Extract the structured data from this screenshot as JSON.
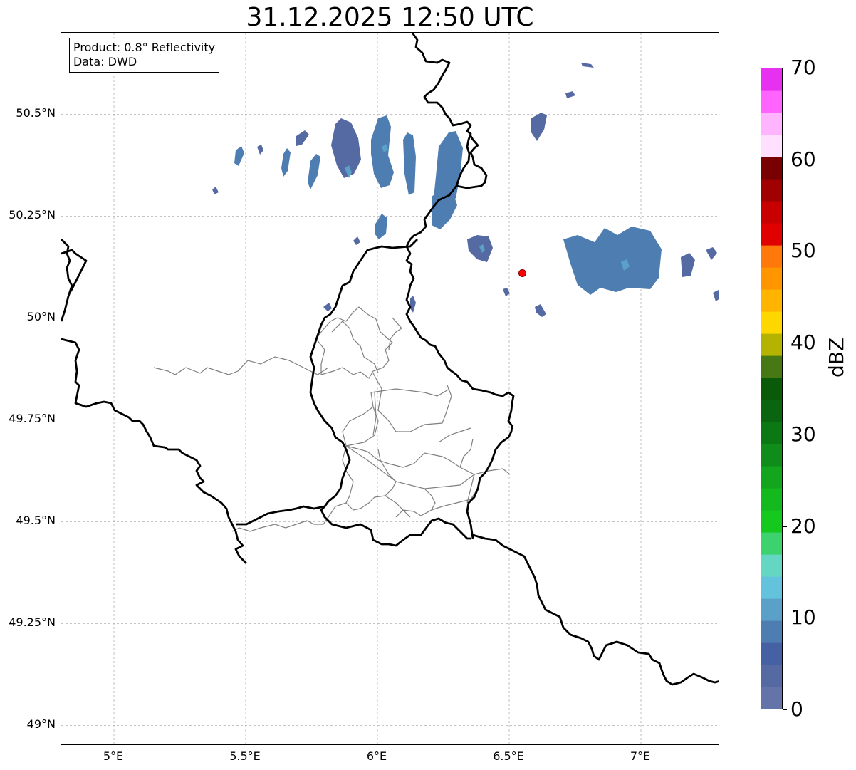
{
  "title": "31.12.2025 12:50 UTC",
  "info": {
    "product": "Product: 0.8° Reflectivity",
    "data": "Data: DWD"
  },
  "map": {
    "lon_range": [
      4.8,
      7.3
    ],
    "lat_range": [
      48.95,
      50.7
    ],
    "lat_ticks": [
      {
        "value": 50.5,
        "label": "50.5°N"
      },
      {
        "value": 50.25,
        "label": "50.25°N"
      },
      {
        "value": 50.0,
        "label": "50°N"
      },
      {
        "value": 49.75,
        "label": "49.75°N"
      },
      {
        "value": 49.5,
        "label": "49.5°N"
      },
      {
        "value": 49.25,
        "label": "49.25°N"
      },
      {
        "value": 49.0,
        "label": "49°N"
      }
    ],
    "lon_ticks": [
      {
        "value": 5.0,
        "label": "5°E"
      },
      {
        "value": 5.5,
        "label": "5.5°E"
      },
      {
        "value": 6.0,
        "label": "6°E"
      },
      {
        "value": 6.5,
        "label": "6.5°E"
      },
      {
        "value": 7.0,
        "label": "7°E"
      }
    ],
    "radar_site": {
      "lon": 6.55,
      "lat": 50.11
    },
    "colors": {
      "border": "#000000",
      "province_border": "#808080",
      "grid": "#b0b0b0",
      "radar_marker": "#ff0000"
    }
  },
  "colorbar": {
    "label": "dBZ",
    "min": 0,
    "max": 70,
    "ticks": [
      {
        "value": 70,
        "label": "70"
      },
      {
        "value": 60,
        "label": "60"
      },
      {
        "value": 50,
        "label": "50"
      },
      {
        "value": 40,
        "label": "40"
      },
      {
        "value": 30,
        "label": "30"
      },
      {
        "value": 20,
        "label": "20"
      },
      {
        "value": 10,
        "label": "10"
      },
      {
        "value": 0,
        "label": "0"
      }
    ],
    "colors": [
      "#6473a8",
      "#5569a3",
      "#4560a3",
      "#4e7db2",
      "#5aa0c8",
      "#64c3dc",
      "#64d7c3",
      "#3cd26e",
      "#14c81e",
      "#14b91e",
      "#14a51e",
      "#0f8c19",
      "#0c7814",
      "#0a6410",
      "#0a5a0a",
      "#467814",
      "#b4b400",
      "#ffd700",
      "#ffb400",
      "#ff9600",
      "#ff780a",
      "#e10000",
      "#c80000",
      "#a00000",
      "#780000",
      "#ffe1ff",
      "#ffb4ff",
      "#ff64ff",
      "#e632f0"
    ]
  }
}
